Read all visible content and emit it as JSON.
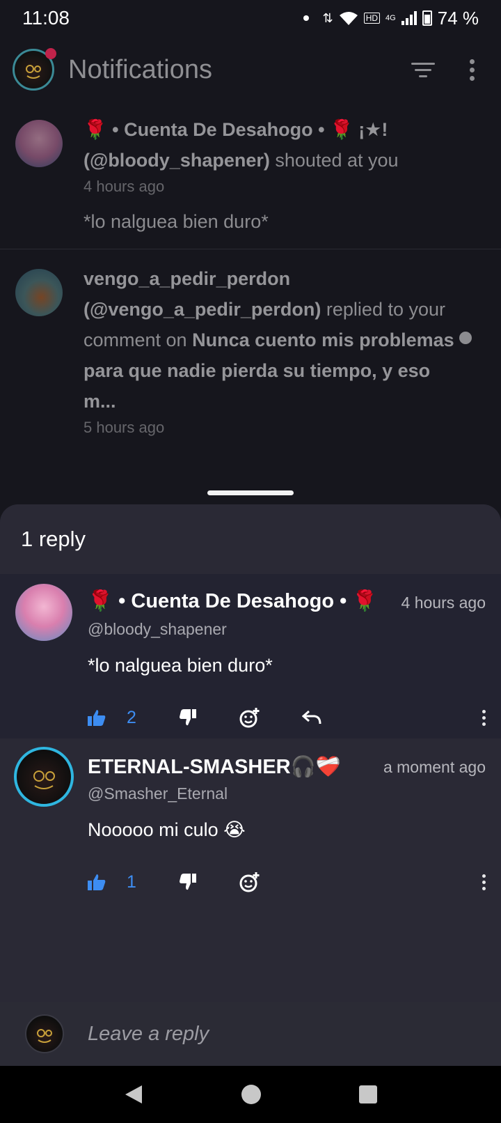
{
  "status_bar": {
    "time": "11:08",
    "battery": "74 %",
    "network": "4G",
    "hd": "HD"
  },
  "header": {
    "title": "Notifications"
  },
  "notifications": [
    {
      "name_rich": "🌹 • Cuenta De Desahogo • 🌹 ¡★!",
      "handle": "(@bloody_shapener)",
      "action": "shouted at you",
      "time": "4 hours ago",
      "preview": "*lo nalguea bien duro*"
    },
    {
      "name": "vengo_a_pedir_perdon",
      "handle": "(@vengo_a_pedir_perdon)",
      "action_pre": "replied to your comment on",
      "post_title": "Nunca cuento mis problemas para que nadie pierda su tiempo, y eso m...",
      "time": "5 hours ago"
    }
  ],
  "sheet": {
    "title": "1 reply",
    "comments": [
      {
        "name": "🌹 • Cuenta De Desahogo • 🌹",
        "handle": "@bloody_shapener",
        "time": "4 hours ago",
        "text": "*lo nalguea bien duro*",
        "likes": "2"
      },
      {
        "name": "ETERNAL-SMASHER🎧❤️‍🩹",
        "handle": "@Smasher_Eternal",
        "time": "a moment ago",
        "text": "Nooooo mi culo 😭",
        "likes": "1"
      }
    ],
    "reply_placeholder": "Leave a reply"
  },
  "colors": {
    "accent": "#3d8df2",
    "sheet_bg": "#232331",
    "page_bg": "#16161d"
  }
}
